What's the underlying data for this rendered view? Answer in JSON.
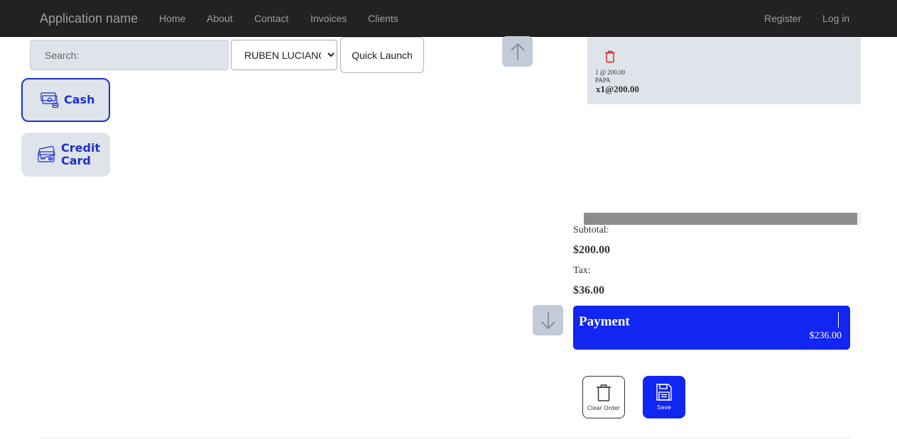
{
  "navbar": {
    "brand": "Application name",
    "links": [
      "Home",
      "About",
      "Contact",
      "Invoices",
      "Clients"
    ],
    "right_links": [
      "Register",
      "Log in"
    ]
  },
  "search": {
    "placeholder": "Search:"
  },
  "client_select": {
    "selected": "RUBEN LUCIANO"
  },
  "quick_launch": {
    "label": "Quick Launch"
  },
  "payment_methods": [
    {
      "label_line1": "Cash",
      "label_line2": "",
      "icon": "cash-icon",
      "selected": true
    },
    {
      "label_line1": "Credit",
      "label_line2": "Card",
      "icon": "credit-card-icon",
      "selected": false
    }
  ],
  "order": {
    "items": [
      {
        "qty_price": "1 @ 200.00",
        "name": "PAPA",
        "line": "x1@200.00"
      }
    ]
  },
  "totals": {
    "subtotal_label": "Subtotal:",
    "subtotal_value": "$200.00",
    "tax_label": "Tax:",
    "tax_value": "$36.00"
  },
  "payment": {
    "title": "Payment",
    "amount": "$236.00"
  },
  "actions": {
    "clear_label": "Clear Order",
    "save_label": "Save"
  },
  "colors": {
    "accent": "#1126f0",
    "method_text": "#1b33c8",
    "tile_bg": "#dfe3ea",
    "navbar_bg": "#222222",
    "delete_red": "#e0201c"
  }
}
